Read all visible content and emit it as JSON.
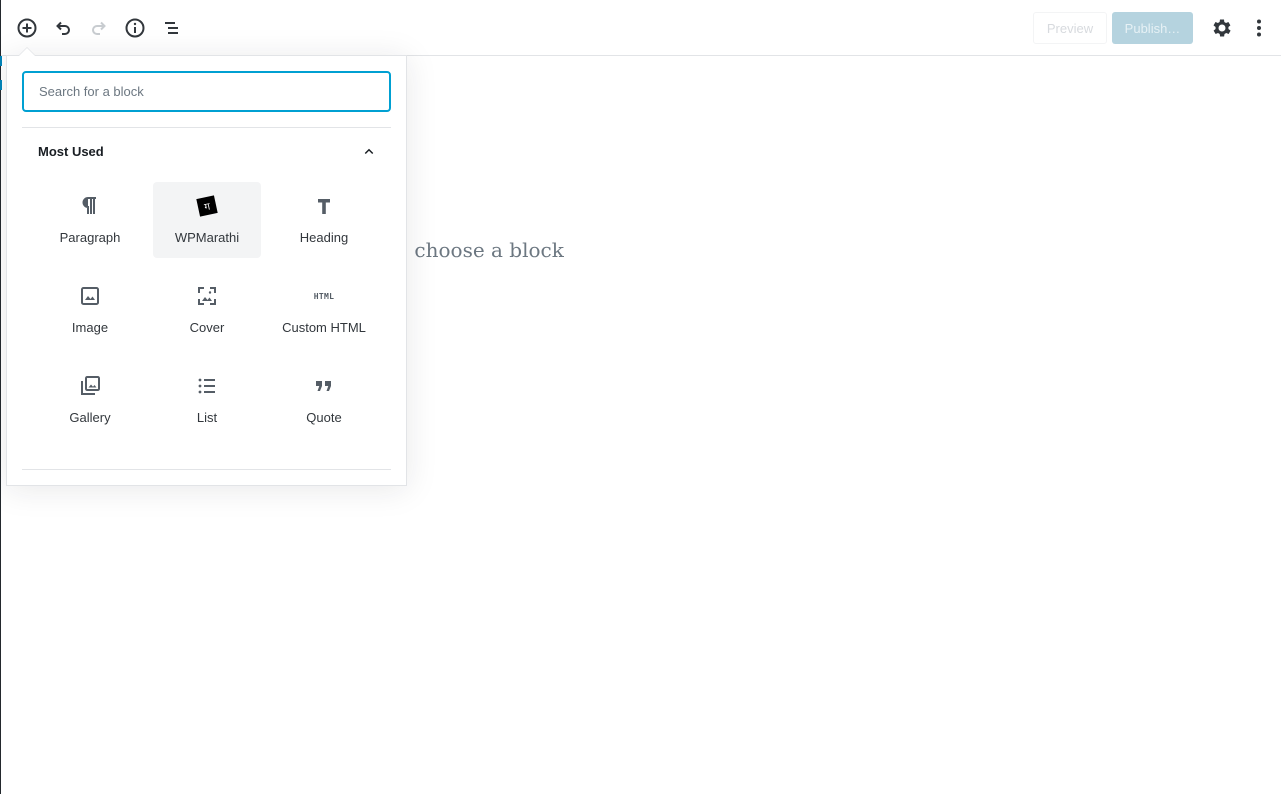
{
  "toolbar": {
    "add_block": "add-block",
    "undo": "undo",
    "redo": "redo",
    "info": "content-structure",
    "outline": "block-navigation",
    "preview_label": "Preview",
    "publish_label": "Publish…",
    "settings": "settings",
    "more": "more-tools"
  },
  "editor": {
    "placeholder_visible": "o choose a block"
  },
  "inserter": {
    "search_placeholder": "Search for a block",
    "search_value": "",
    "panel_title": "Most Used",
    "panel_expanded": true,
    "blocks": [
      {
        "label": "Paragraph",
        "icon": "paragraph-icon",
        "active": false
      },
      {
        "label": "WPMarathi",
        "icon": "wpmarathi-icon",
        "glyph": "ग",
        "active": true
      },
      {
        "label": "Heading",
        "icon": "heading-icon",
        "active": false
      },
      {
        "label": "Image",
        "icon": "image-icon",
        "active": false
      },
      {
        "label": "Cover",
        "icon": "cover-icon",
        "active": false
      },
      {
        "label": "Custom HTML",
        "icon": "html-icon",
        "glyph": "HTML",
        "active": false
      },
      {
        "label": "Gallery",
        "icon": "gallery-icon",
        "active": false
      },
      {
        "label": "List",
        "icon": "list-icon",
        "active": false
      },
      {
        "label": "Quote",
        "icon": "quote-icon",
        "active": false
      }
    ]
  },
  "colors": {
    "accent": "#00a0d2",
    "publish_disabled_bg": "#b5d3df",
    "icon": "#555d66",
    "left_bar": "#23282d"
  }
}
